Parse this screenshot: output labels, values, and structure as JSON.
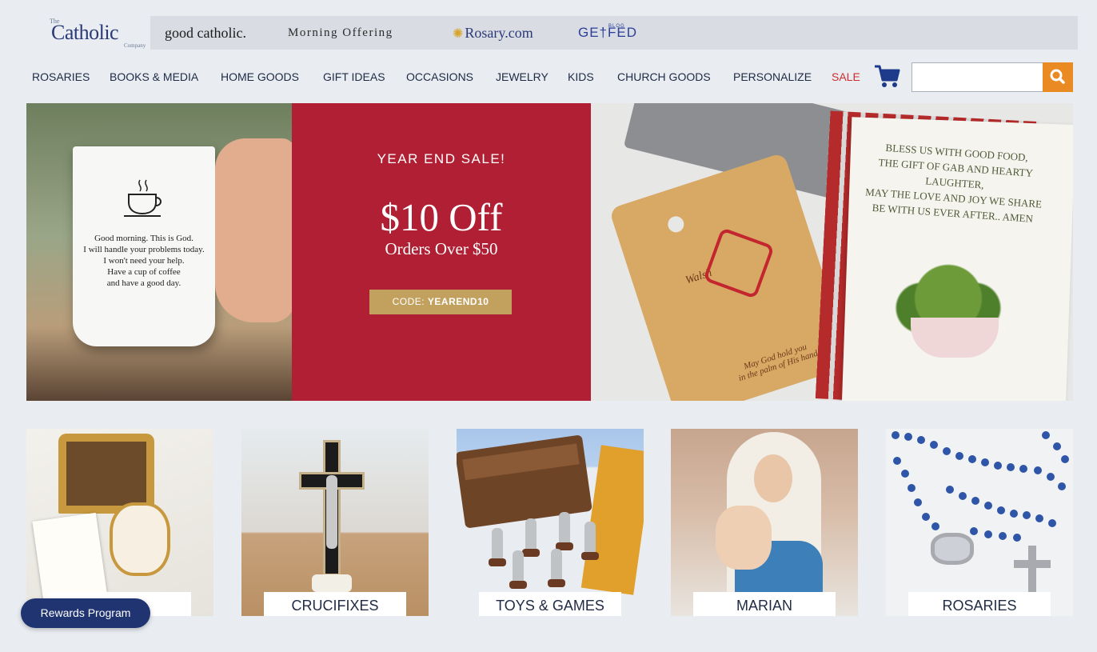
{
  "brand": {
    "logo_the": "The",
    "logo_name": "Catholic",
    "logo_company": "Company",
    "sister_sites": {
      "good_catholic": "good catholic.",
      "morning_offering": "Morning Offering",
      "rosary": "Rosary.com",
      "getfed": "GE†FED",
      "getfed_sub": "BLOG"
    }
  },
  "nav": {
    "items": [
      "ROSARIES",
      "BOOKS & MEDIA",
      "HOME GOODS",
      "GIFT IDEAS",
      "OCCASIONS",
      "JEWELRY",
      "KIDS",
      "CHURCH GOODS",
      "PERSONALIZE"
    ],
    "sale": "SALE",
    "sale_color": "#d22b2b",
    "cart_icon": "cart-icon",
    "search": {
      "placeholder": "",
      "button_icon": "search-icon",
      "button_color": "#e98a22"
    }
  },
  "hero": {
    "eyebrow": "YEAR END SALE!",
    "headline": "$10 Off",
    "subhead": "Orders Over $50",
    "code_prefix": "CODE: ",
    "code_value": "YEAREND10",
    "panel_color": "#b01f33",
    "code_color": "#c2a15f",
    "mug_text": [
      "Good morning. This is God.",
      "I will handle your problems today.",
      "I won't need your help.",
      "Have a cup of coffee",
      "and have a good day."
    ],
    "board_text": [
      "Walsh",
      "May God hold you",
      "in the palm of His hand"
    ],
    "towel_text": [
      "Bless us with good food,",
      "the gift of gab and hearty laughter,",
      "may the love and joy we share",
      "be with us ever after.. Amen"
    ]
  },
  "categories": [
    {
      "label": "OFF!"
    },
    {
      "label": "CRUCIFIXES"
    },
    {
      "label": "TOYS & GAMES"
    },
    {
      "label": "MARIAN"
    },
    {
      "label": "ROSARIES"
    }
  ],
  "rewards": {
    "label": "Rewards Program"
  }
}
